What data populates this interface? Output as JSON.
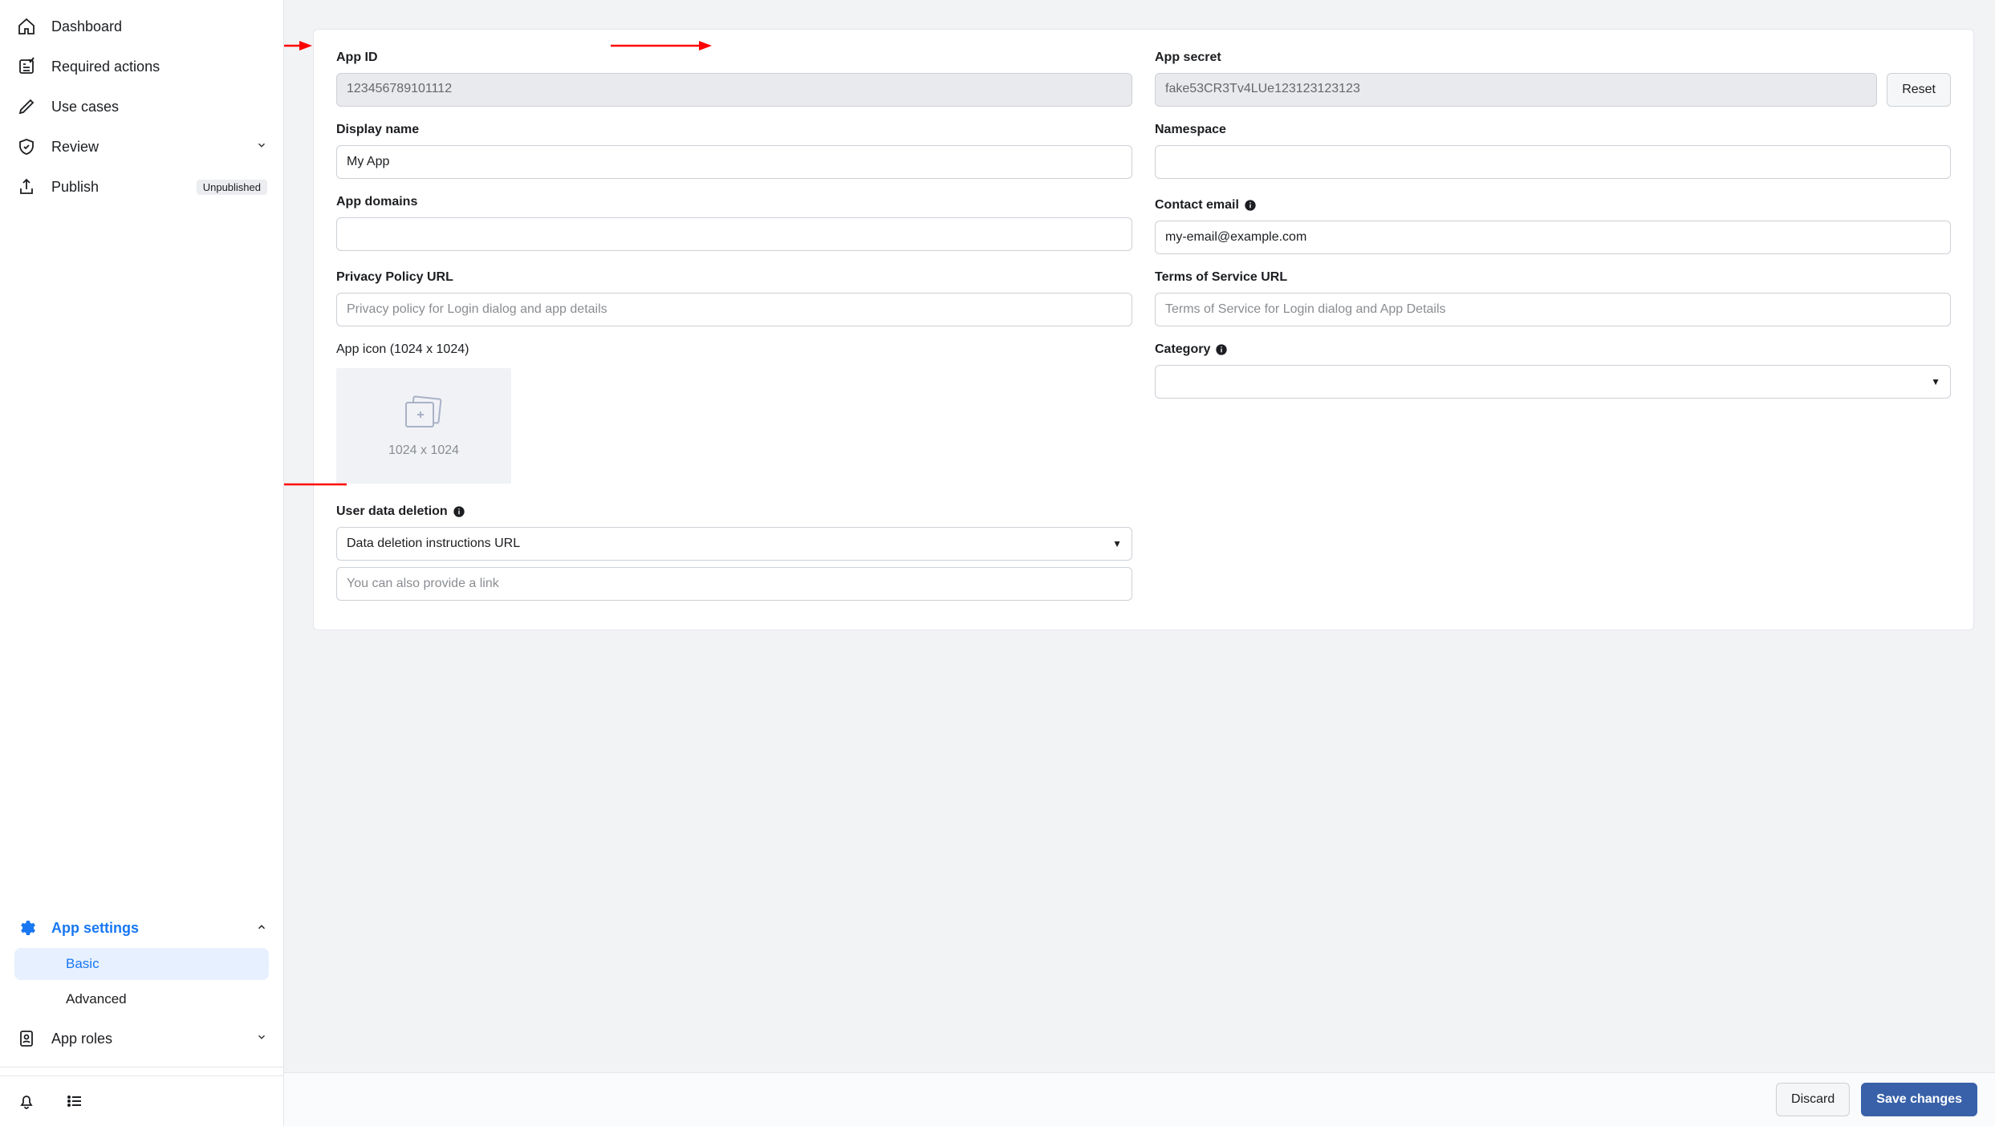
{
  "sidebar": {
    "items": [
      {
        "label": "Dashboard"
      },
      {
        "label": "Required actions"
      },
      {
        "label": "Use cases"
      },
      {
        "label": "Review"
      }
    ],
    "publish": {
      "label": "Publish",
      "badge": "Unpublished"
    },
    "app_settings": {
      "label": "App settings",
      "basic": "Basic",
      "advanced": "Advanced"
    },
    "app_roles": {
      "label": "App roles"
    }
  },
  "form": {
    "app_id": {
      "label": "App ID",
      "value": "123456789101112"
    },
    "app_secret": {
      "label": "App secret",
      "value": "fake53CR3Tv4LUe123123123123",
      "reset": "Reset"
    },
    "display_name": {
      "label": "Display name",
      "value": "My App"
    },
    "namespace": {
      "label": "Namespace",
      "value": ""
    },
    "app_domains": {
      "label": "App domains",
      "value": ""
    },
    "contact_email": {
      "label": "Contact email",
      "value": "my-email@example.com"
    },
    "privacy_url": {
      "label": "Privacy Policy URL",
      "placeholder": "Privacy policy for Login dialog and app details"
    },
    "tos_url": {
      "label": "Terms of Service URL",
      "placeholder": "Terms of Service for Login dialog and App Details"
    },
    "app_icon": {
      "label": "App icon (1024 x 1024)",
      "hint": "1024 x 1024"
    },
    "category": {
      "label": "Category"
    },
    "user_data_deletion": {
      "label": "User data deletion",
      "selected": "Data deletion instructions URL",
      "link_placeholder": "You can also provide a link"
    }
  },
  "buttons": {
    "discard": "Discard",
    "save": "Save changes"
  }
}
